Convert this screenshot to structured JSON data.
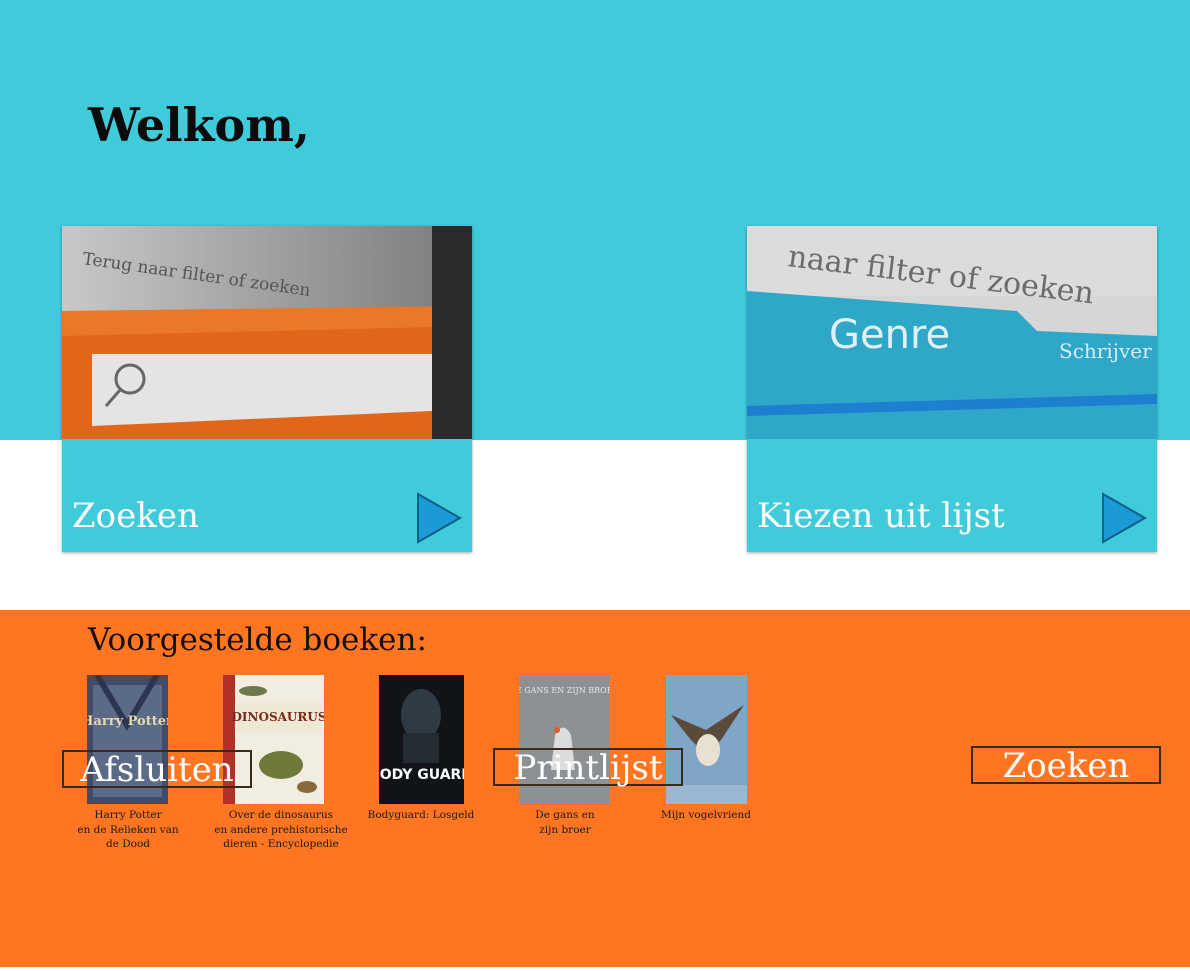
{
  "header": {
    "welcome": "Welkom,"
  },
  "cards": [
    {
      "label": "Zoeken",
      "image_text": "Terug naar filter of zoeken",
      "icon": "play-arrow-icon"
    },
    {
      "label": "Kiezen uit lijst",
      "image_text": "naar filter of zoeken",
      "tab1": "Genre",
      "tab2": "Schrijver",
      "icon": "play-arrow-icon"
    }
  ],
  "suggestions": {
    "title": "Voorgestelde boeken:",
    "books": [
      {
        "caption": "Harry Potter\nen de Relieken van\nde Dood",
        "cover_text": "Harry Potter"
      },
      {
        "caption": "Over de dinosaurus\nen andere prehistorische\ndieren - Encyclopedie",
        "cover_text": "DINOSAURUS"
      },
      {
        "caption": "Bodyguard: Losgeld",
        "cover_text": "BODY GUARD"
      },
      {
        "caption": "De gans en\nzijn broer",
        "cover_text": "DE GANS EN ZIJN BROER"
      },
      {
        "caption": "Mijn vogelvriend",
        "cover_text": ""
      }
    ]
  },
  "buttons": {
    "close": "Afsluiten",
    "print": "Printlijst",
    "search": "Zoeken"
  },
  "colors": {
    "top_band": "#40cbdb",
    "bottom_band": "#ff7521",
    "arrow": "#1a9ad6"
  }
}
